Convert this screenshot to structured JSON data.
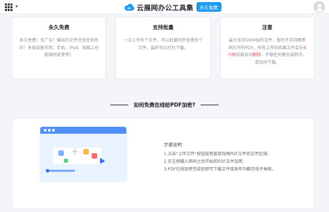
{
  "header": {
    "brand_name": "云展网办公工具集",
    "badge": "永久免费",
    "icons": {
      "menu": "grid-menu-icon",
      "logo": "cloud-logo-icon",
      "user": "user-avatar-icon"
    }
  },
  "features": [
    {
      "title": "永久免费",
      "desc": "永久免费！无广告！输出的文件也无任何水印！多端设备可用，手机、iPad、电脑上也能随时能使用！"
    },
    {
      "title": "支持批量",
      "desc": "一次上传多个文件，可以批量同步处理多个文件，最终可以打包下载。"
    },
    {
      "title": "注意",
      "desc_before": "最大支持500MB的文件，暂时不支持图密码打开的PDF。所有上传和结果文件会在",
      "desc_highlight": "6小时",
      "desc_middle": "后被自动",
      "desc_highlight2": "删除",
      "desc_after": "，不做任何备份或转存，请及时下载。"
    }
  ],
  "section": {
    "title": "如何免费在线给PDF加密?"
  },
  "steps": {
    "title": "步骤说明",
    "items": [
      "1.点击\"上传文件\"按钮或者直接拖拽PDF文件到文件区域;",
      "2.在左侧输入密码之后开始的PDF文件加密;",
      "3.PDF在线加密完成后即可下载文件或发布为翻页电子画册。"
    ]
  },
  "colors": {
    "accent": "#1d9bf0",
    "highlight": "#e5484d",
    "illustration_blue": "#4f8ef7"
  }
}
